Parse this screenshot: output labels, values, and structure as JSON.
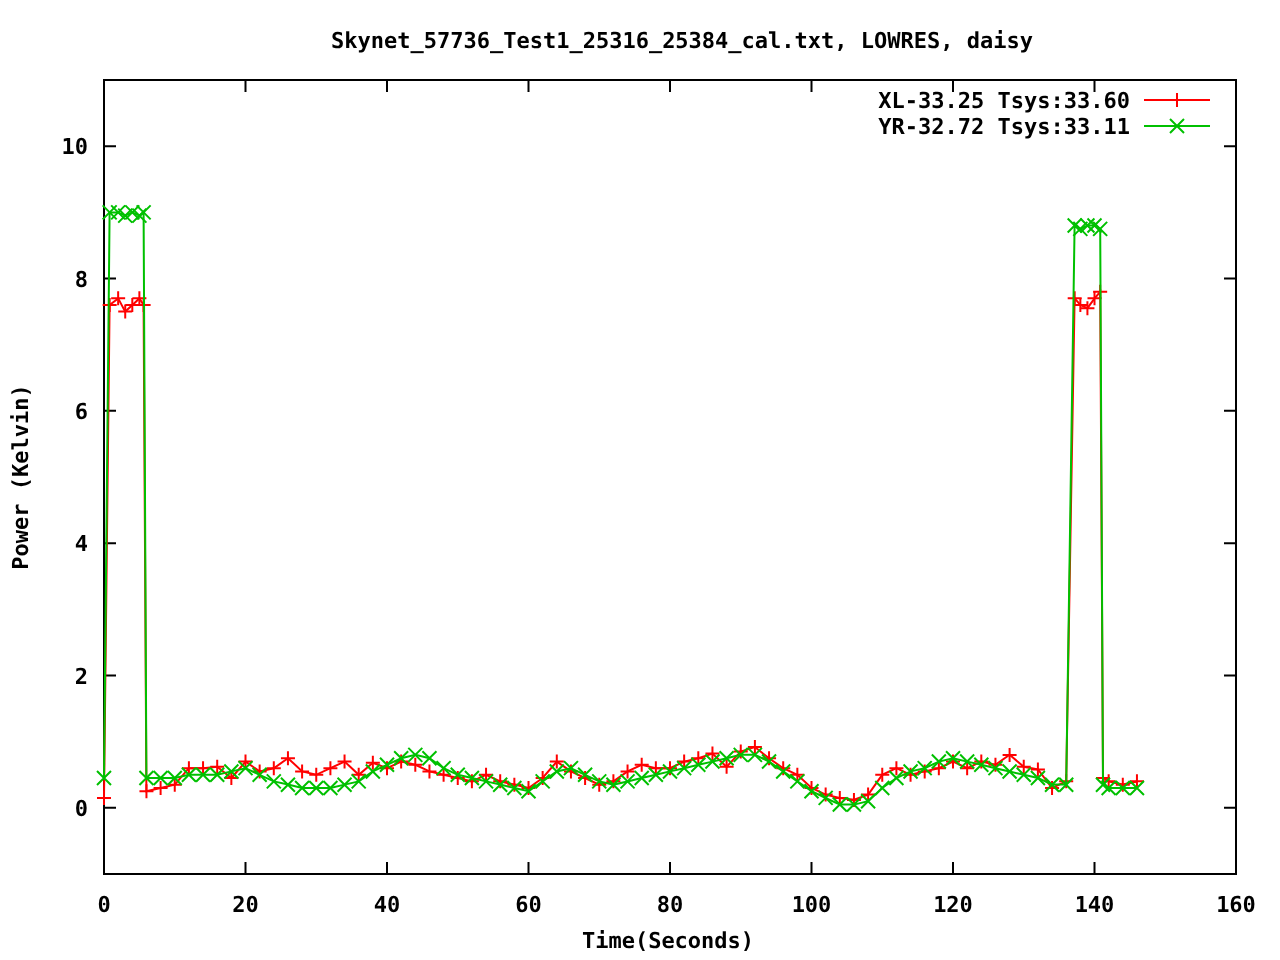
{
  "chart_data": {
    "type": "line",
    "title": "Skynet_57736_Test1_25316_25384_cal.txt, LOWRES, daisy",
    "xlabel": "Time(Seconds)",
    "ylabel": "Power (Kelvin)",
    "x": [
      0,
      0.8,
      2,
      3,
      4,
      5,
      5.6,
      6,
      8,
      10,
      12,
      14,
      16,
      18,
      20,
      22,
      24,
      26,
      28,
      30,
      32,
      34,
      36,
      38,
      40,
      42,
      44,
      46,
      48,
      50,
      52,
      54,
      56,
      58,
      60,
      62,
      64,
      66,
      68,
      70,
      72,
      74,
      76,
      78,
      80,
      82,
      84,
      86,
      88,
      90,
      92,
      94,
      96,
      98,
      100,
      102,
      104,
      106,
      108,
      110,
      112,
      114,
      116,
      118,
      120,
      122,
      124,
      126,
      128,
      130,
      132,
      134,
      136,
      137.2,
      138,
      139,
      140,
      140.8,
      141.2,
      142,
      144,
      146
    ],
    "series": [
      {
        "name": "XL-33.25 Tsys:33.60",
        "color": "#ff0000",
        "marker": "plus",
        "values": [
          0.15,
          7.6,
          7.7,
          7.5,
          7.6,
          7.7,
          7.6,
          0.25,
          0.3,
          0.35,
          0.6,
          0.6,
          0.62,
          0.45,
          0.7,
          0.55,
          0.6,
          0.75,
          0.55,
          0.5,
          0.6,
          0.7,
          0.5,
          0.68,
          0.6,
          0.7,
          0.65,
          0.55,
          0.5,
          0.45,
          0.4,
          0.5,
          0.4,
          0.35,
          0.3,
          0.45,
          0.7,
          0.55,
          0.45,
          0.35,
          0.4,
          0.55,
          0.65,
          0.6,
          0.6,
          0.7,
          0.75,
          0.82,
          0.62,
          0.85,
          0.92,
          0.75,
          0.6,
          0.5,
          0.3,
          0.2,
          0.15,
          0.12,
          0.2,
          0.5,
          0.6,
          0.5,
          0.55,
          0.6,
          0.7,
          0.6,
          0.7,
          0.65,
          0.8,
          0.62,
          0.58,
          0.3,
          0.4,
          7.7,
          7.6,
          7.55,
          7.7,
          7.8,
          0.45,
          0.4,
          0.35,
          0.4
        ]
      },
      {
        "name": "YR-32.72 Tsys:33.11",
        "color": "#00c000",
        "marker": "cross",
        "values": [
          0.45,
          9.0,
          9.0,
          8.95,
          9.0,
          8.95,
          9.0,
          0.45,
          0.45,
          0.45,
          0.5,
          0.5,
          0.5,
          0.55,
          0.6,
          0.5,
          0.4,
          0.35,
          0.3,
          0.3,
          0.3,
          0.35,
          0.4,
          0.55,
          0.65,
          0.75,
          0.8,
          0.75,
          0.6,
          0.5,
          0.45,
          0.4,
          0.35,
          0.3,
          0.25,
          0.4,
          0.55,
          0.6,
          0.5,
          0.4,
          0.35,
          0.4,
          0.45,
          0.5,
          0.55,
          0.6,
          0.65,
          0.7,
          0.75,
          0.8,
          0.8,
          0.7,
          0.55,
          0.4,
          0.25,
          0.15,
          0.05,
          0.05,
          0.1,
          0.3,
          0.45,
          0.55,
          0.6,
          0.7,
          0.75,
          0.7,
          0.65,
          0.6,
          0.55,
          0.5,
          0.45,
          0.35,
          0.35,
          8.8,
          8.75,
          8.8,
          8.8,
          8.75,
          0.35,
          0.3,
          0.3,
          0.3
        ]
      }
    ],
    "legend": true,
    "xlim": [
      0,
      160
    ],
    "ylim": [
      -1,
      11
    ],
    "xticks": [
      0,
      20,
      40,
      60,
      80,
      100,
      120,
      140,
      160
    ],
    "yticks": [
      0,
      2,
      4,
      6,
      8,
      10
    ]
  }
}
